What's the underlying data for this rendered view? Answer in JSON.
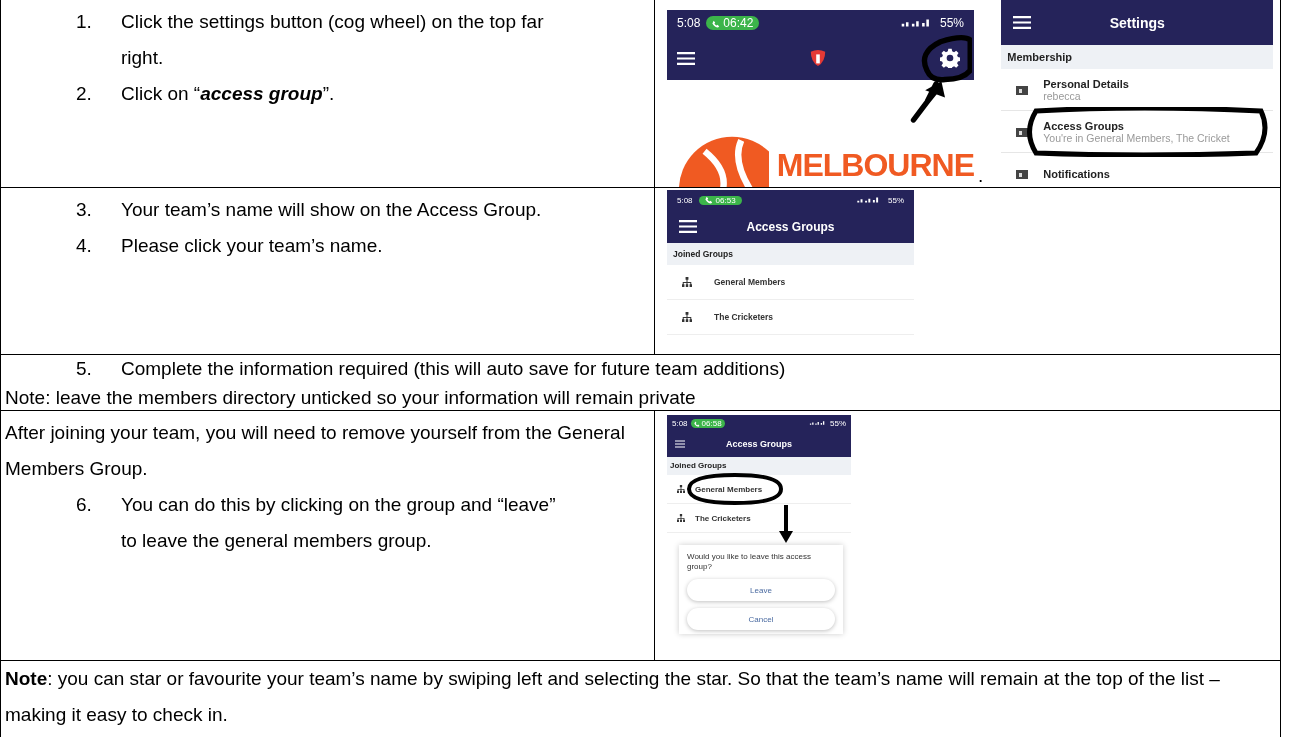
{
  "rows": [
    {
      "kind": "split",
      "steps": [
        {
          "number": "1.",
          "text": "Click the settings button (cog wheel) on the top far right."
        },
        {
          "number": "2.",
          "text": "Click on “",
          "emphasis": "access group",
          "after": "”."
        }
      ],
      "screens": [
        {
          "kind": "home",
          "time": "5:08",
          "call": "06:42",
          "battery": "55%",
          "brand": "MELBOURNE",
          "annotated": true,
          "after": "."
        },
        {
          "kind": "settings",
          "title": "Settings",
          "section": "Membership",
          "annotated": true,
          "items": [
            {
              "title": "Personal Details",
              "subtitle": "rebecca"
            },
            {
              "title": "Access Groups",
              "subtitle": "You're in General Members, The Cricket"
            },
            {
              "title": "Notifications"
            }
          ]
        }
      ]
    },
    {
      "kind": "split",
      "steps": [
        {
          "number": "3.",
          "text": "Your team’s name will show on the Access Group."
        },
        {
          "number": "4.",
          "text": "Please click your team’s name."
        }
      ],
      "screens": [
        {
          "kind": "groups",
          "time": "5:08",
          "call": "06:53",
          "battery": "55%",
          "title": "Access Groups",
          "section": "Joined Groups",
          "annotated": false,
          "items": [
            "General Members",
            "The Cricketers"
          ]
        }
      ]
    },
    {
      "kind": "full",
      "steps": [
        {
          "number": "5.",
          "text": "Complete the information required (this will auto save for future team additions)"
        }
      ],
      "note": "Note: leave the members directory unticked so your information will remain private"
    },
    {
      "kind": "split",
      "intro": "After joining your team, you will need to remove yourself from the General Members Group.",
      "steps": [
        {
          "number": "6.",
          "text": "You can do this by clicking on the group and “leave” to leave the general members group."
        }
      ],
      "screens": [
        {
          "kind": "groups",
          "time": "5:08",
          "call": "06:58",
          "battery": "55%",
          "title": "Access Groups",
          "section": "Joined Groups",
          "annotated": true,
          "items": [
            "General Members",
            "The Cricketers"
          ],
          "dialog": {
            "question": "Would you like to leave this access group?",
            "buttons": [
              "Leave",
              "Cancel"
            ]
          }
        }
      ]
    },
    {
      "kind": "full",
      "note": "**Note**: you can star or favourite your team’s name by swiping left and selecting the star. So that the team’s name will remain at the top of the list – making it easy to check in."
    }
  ]
}
